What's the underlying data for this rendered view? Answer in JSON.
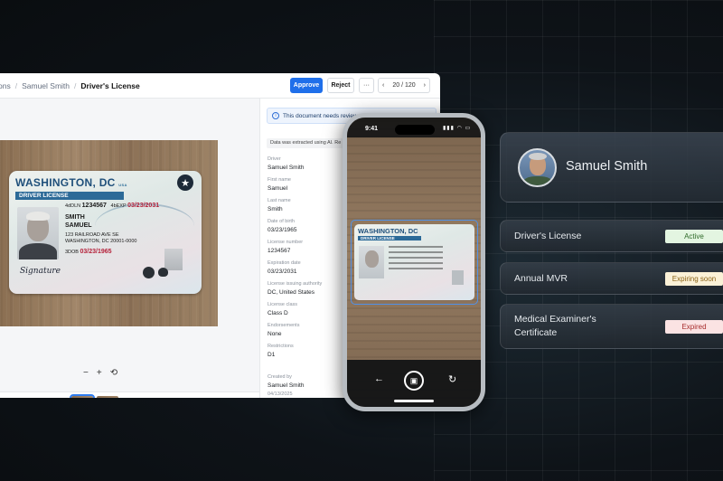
{
  "topbar": {
    "breadcrumbs": [
      "ons",
      "Samuel Smith",
      "Driver's License"
    ],
    "approve_label": "Approve",
    "reject_label": "Reject",
    "more_label": "···",
    "pager": {
      "prev": "‹",
      "text": "20 / 120",
      "next": "›"
    }
  },
  "viewer": {
    "zoom_out": "−",
    "zoom_in": "+",
    "rotate": "⟲",
    "add_label": "+"
  },
  "id_card": {
    "state": "WASHINGTON, DC",
    "state_suffix": "USA",
    "type": "DRIVER LICENSE",
    "number_label": "4dDLN",
    "number": "1234567",
    "exp_label": "4bEXP",
    "exp": "03/23/2031",
    "last": "SMITH",
    "first": "SAMUEL",
    "address1": "123 RAILROAD AVE SE",
    "address2": "WASHINGTON, DC 20001-0000",
    "dob_label": "3DOB",
    "dob": "03/23/1965",
    "signature": "Signature"
  },
  "panel": {
    "notice": "This document needs review",
    "extract_note": "Data was extracted using AI. Re",
    "fields": [
      {
        "label": "Driver",
        "value": "Samuel Smith"
      },
      {
        "label": "First name",
        "value": "Samuel"
      },
      {
        "label": "Last name",
        "value": "Smith"
      },
      {
        "label": "Date of birth",
        "value": "03/23/1965"
      },
      {
        "label": "License number",
        "value": "1234567"
      },
      {
        "label": "Expiration date",
        "value": "03/23/2031"
      },
      {
        "label": "License issuing authority",
        "value": "DC, United States"
      },
      {
        "label": "License class",
        "value": "Class D"
      },
      {
        "label": "Endorsements",
        "value": "None"
      },
      {
        "label": "Restrictions",
        "value": "D1"
      },
      {
        "label": "Created by",
        "value": "Samuel Smith"
      }
    ],
    "created_date": "04/13/2025"
  },
  "phone": {
    "time": "9:41",
    "signal": "▮▮▮ ◠ ▭",
    "card_state": "WASHINGTON, DC",
    "card_type": "DRIVER LICENSE",
    "back_icon": "←",
    "capture_icon": "▣",
    "rotate_icon": "↻"
  },
  "profile": {
    "name": "Samuel Smith"
  },
  "documents": [
    {
      "name": "Driver's License",
      "status": "Active"
    },
    {
      "name": "Annual MVR",
      "status": "Expiring soon"
    },
    {
      "name": "Medical Examiner's Certificate",
      "status": "Expired"
    }
  ],
  "colors": {
    "accent": "#1f6fea",
    "active_bg": "#e3f5e1",
    "expiring_bg": "#fbf1d7",
    "expired_bg": "#fbe3e3"
  }
}
